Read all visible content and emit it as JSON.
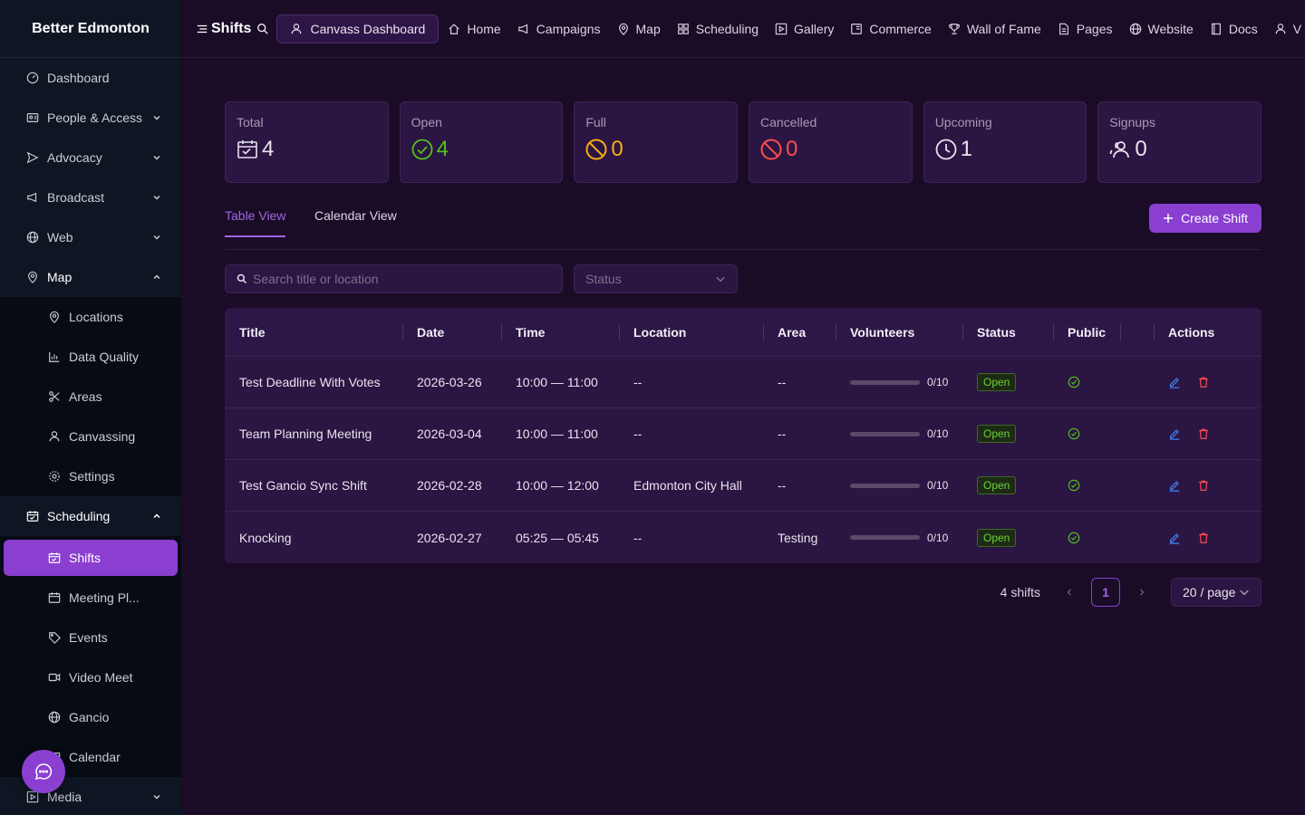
{
  "sidebar": {
    "brand": "Better Edmonton",
    "items": [
      {
        "label": "Dashboard"
      },
      {
        "label": "People & Access"
      },
      {
        "label": "Advocacy"
      },
      {
        "label": "Broadcast"
      },
      {
        "label": "Web"
      },
      {
        "label": "Map"
      }
    ],
    "map_children": [
      {
        "label": "Locations"
      },
      {
        "label": "Data Quality"
      },
      {
        "label": "Areas"
      },
      {
        "label": "Canvassing"
      },
      {
        "label": "Settings"
      }
    ],
    "scheduling": {
      "label": "Scheduling"
    },
    "scheduling_children": [
      {
        "label": "Shifts"
      },
      {
        "label": "Meeting Pl..."
      },
      {
        "label": "Events"
      },
      {
        "label": "Video Meet"
      },
      {
        "label": "Gancio"
      },
      {
        "label": "Calendar"
      }
    ],
    "media": {
      "label": "Media"
    }
  },
  "topbar": {
    "page_title": "Shifts",
    "canvass_button": "Canvass Dashboard",
    "links": [
      "Home",
      "Campaigns",
      "Map",
      "Scheduling",
      "Gallery",
      "Commerce",
      "Wall of Fame",
      "Pages",
      "Website",
      "Docs",
      "V"
    ]
  },
  "stats": [
    {
      "label": "Total",
      "value": "4",
      "icon": "calendar-check-icon",
      "color": "#e8e4ee"
    },
    {
      "label": "Open",
      "value": "4",
      "icon": "check-circle-icon",
      "color": "#52c41a"
    },
    {
      "label": "Full",
      "value": "0",
      "icon": "stop-icon",
      "color": "#faad14"
    },
    {
      "label": "Cancelled",
      "value": "0",
      "icon": "stop-icon",
      "color": "#ff4d4f"
    },
    {
      "label": "Upcoming",
      "value": "1",
      "icon": "clock-icon",
      "color": "#e8e4ee"
    },
    {
      "label": "Signups",
      "value": "0",
      "icon": "team-icon",
      "color": "#e8e4ee"
    }
  ],
  "tabs": {
    "table": "Table View",
    "calendar": "Calendar View"
  },
  "create_button": "Create Shift",
  "filters": {
    "search_placeholder": "Search title or location",
    "status_placeholder": "Status"
  },
  "table": {
    "columns": [
      "Title",
      "Date",
      "Time",
      "Location",
      "Area",
      "Volunteers",
      "Status",
      "Public",
      "Actions"
    ],
    "rows": [
      {
        "title": "Test Deadline With Votes",
        "date": "2026-03-26",
        "time": "10:00 — 11:00",
        "location": "--",
        "area": "--",
        "volunteers": "0/10",
        "fill": 0,
        "status": "Open"
      },
      {
        "title": "Team Planning Meeting",
        "date": "2026-03-04",
        "time": "10:00 — 11:00",
        "location": "--",
        "area": "--",
        "volunteers": "0/10",
        "fill": 0,
        "status": "Open"
      },
      {
        "title": "Test Gancio Sync Shift",
        "date": "2026-02-28",
        "time": "10:00 — 12:00",
        "location": "Edmonton City Hall",
        "area": "--",
        "volunteers": "0/10",
        "fill": 0,
        "status": "Open"
      },
      {
        "title": "Knocking",
        "date": "2026-02-27",
        "time": "05:25 — 05:45",
        "location": "--",
        "area": "Testing",
        "volunteers": "0/10",
        "fill": 0,
        "status": "Open"
      }
    ]
  },
  "pager": {
    "total": "4 shifts",
    "current_page": "1",
    "page_size": "20 / page"
  },
  "colors": {
    "accent": "#8a3fd0",
    "sidebar_bg": "#0f1623",
    "page_bg": "#1a0b27"
  }
}
